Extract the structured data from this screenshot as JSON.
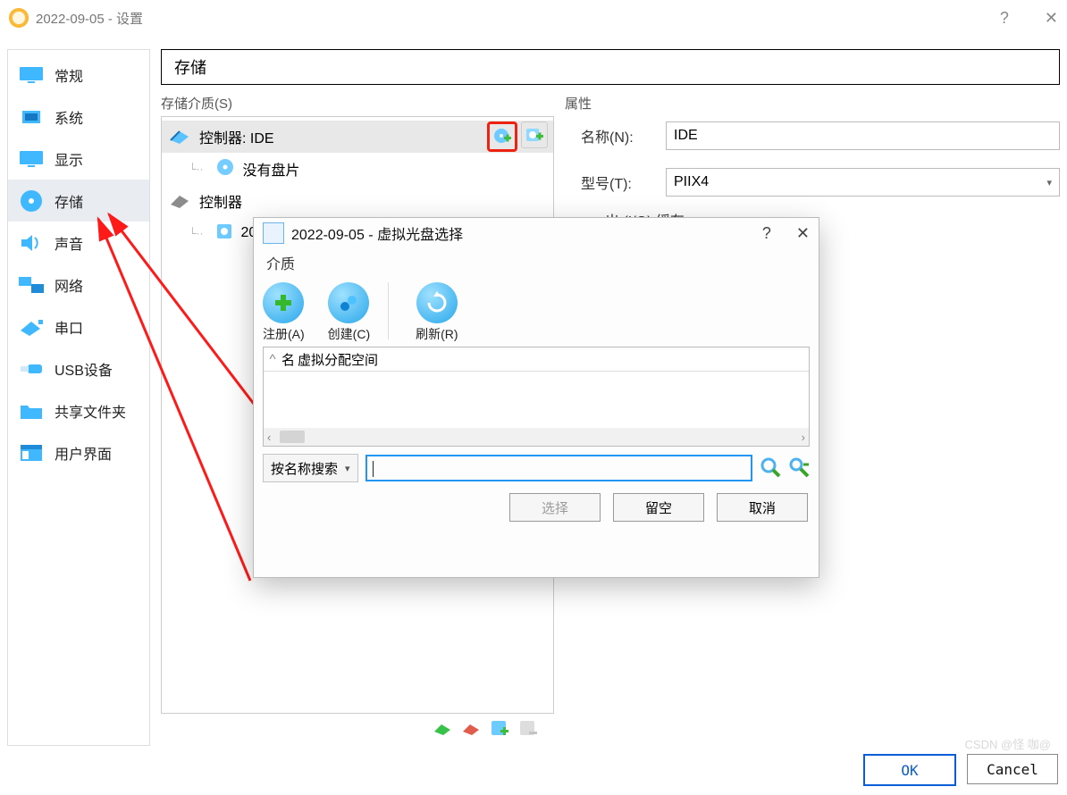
{
  "title": "2022-09-05 - 设置",
  "titlebar_help": "?",
  "titlebar_close": "✕",
  "sidebar": {
    "items": [
      {
        "label": "常规"
      },
      {
        "label": "系统"
      },
      {
        "label": "显示"
      },
      {
        "label": "存储"
      },
      {
        "label": "声音"
      },
      {
        "label": "网络"
      },
      {
        "label": "串口"
      },
      {
        "label": "USB设备"
      },
      {
        "label": "共享文件夹"
      },
      {
        "label": "用户界面"
      }
    ]
  },
  "main": {
    "heading": "存储",
    "storage_group_label": "存储介质(S)",
    "tree": {
      "controller_ide": "控制器: IDE",
      "no_disc": "没有盘片",
      "controller_other": "控制器",
      "item2": "20"
    },
    "attr_group_label": "属性",
    "name_label": "名称(N):",
    "name_value": "IDE",
    "model_label": "型号(T):",
    "model_value": "PIIX4",
    "iocache_text": "出 (I/O) 缓存"
  },
  "modal": {
    "title": "2022-09-05 - 虚拟光盘选择",
    "help": "?",
    "close": "✕",
    "sub": "介质",
    "tool_register": "注册(A)",
    "tool_create": "创建(C)",
    "tool_refresh": "刷新(R)",
    "list_col_name_short": "名",
    "list_col_name": "虚拟分配空间",
    "search_mode": "按名称搜索",
    "search_value": "",
    "btn_select": "选择",
    "btn_empty": "留空",
    "btn_cancel": "取消"
  },
  "footer": {
    "ok": "OK",
    "cancel": "Cancel"
  },
  "watermark": "CSDN @怪 咖@"
}
